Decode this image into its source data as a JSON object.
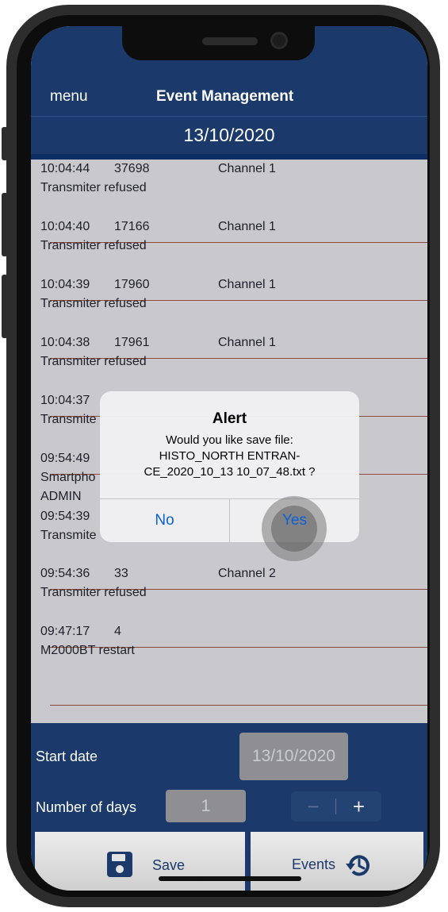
{
  "header": {
    "menu_label": "menu",
    "title": "Event Management",
    "date": "13/10/2020"
  },
  "events": [
    {
      "time": "10:04:44",
      "code": "37698",
      "channel": "Channel 1",
      "description": "Transmiter refused",
      "extra": ""
    },
    {
      "time": "10:04:40",
      "code": "17166",
      "channel": "Channel 1",
      "description": "Transmiter refused",
      "extra": ""
    },
    {
      "time": "10:04:39",
      "code": "17960",
      "channel": "Channel 1",
      "description": "Transmiter refused",
      "extra": ""
    },
    {
      "time": "10:04:38",
      "code": "17961",
      "channel": "Channel 1",
      "description": "Transmiter refused",
      "extra": ""
    },
    {
      "time": "10:04:37",
      "code": "",
      "channel": "",
      "description": "Transmite",
      "extra": ""
    },
    {
      "time": "09:54:49",
      "code": "",
      "channel": "",
      "description": "Smartpho",
      "extra": "ADMIN"
    },
    {
      "time": "09:54:39",
      "code": "",
      "channel": "",
      "description": "Transmite",
      "extra": ""
    },
    {
      "time": "09:54:36",
      "code": "33",
      "channel": "Channel 2",
      "description": "Transmiter refused",
      "extra": ""
    },
    {
      "time": "09:47:17",
      "code": "4",
      "channel": "",
      "description": "M2000BT restart",
      "extra": ""
    }
  ],
  "bottom_panel": {
    "start_date_label": "Start date",
    "start_date_value": "13/10/2020",
    "days_label": "Number of days",
    "days_value": "1",
    "stepper_minus": "−",
    "stepper_plus": "+",
    "save_label": "Save",
    "events_label": "Events"
  },
  "alert": {
    "title": "Alert",
    "message_line1": "Would you like  save file:",
    "message_line2": "HISTO_NORTH ENTRAN-",
    "message_line3": "CE_2020_10_13 10_07_48.txt ?",
    "no_label": "No",
    "yes_label": "Yes"
  },
  "colors": {
    "header_bg": "#1b3a6b",
    "list_bg": "#c9c8cd",
    "separator": "#8b4a3a",
    "alert_button": "#0a63d6"
  },
  "icons": {
    "save": "floppy-disk-icon",
    "events": "history-clock-icon"
  }
}
